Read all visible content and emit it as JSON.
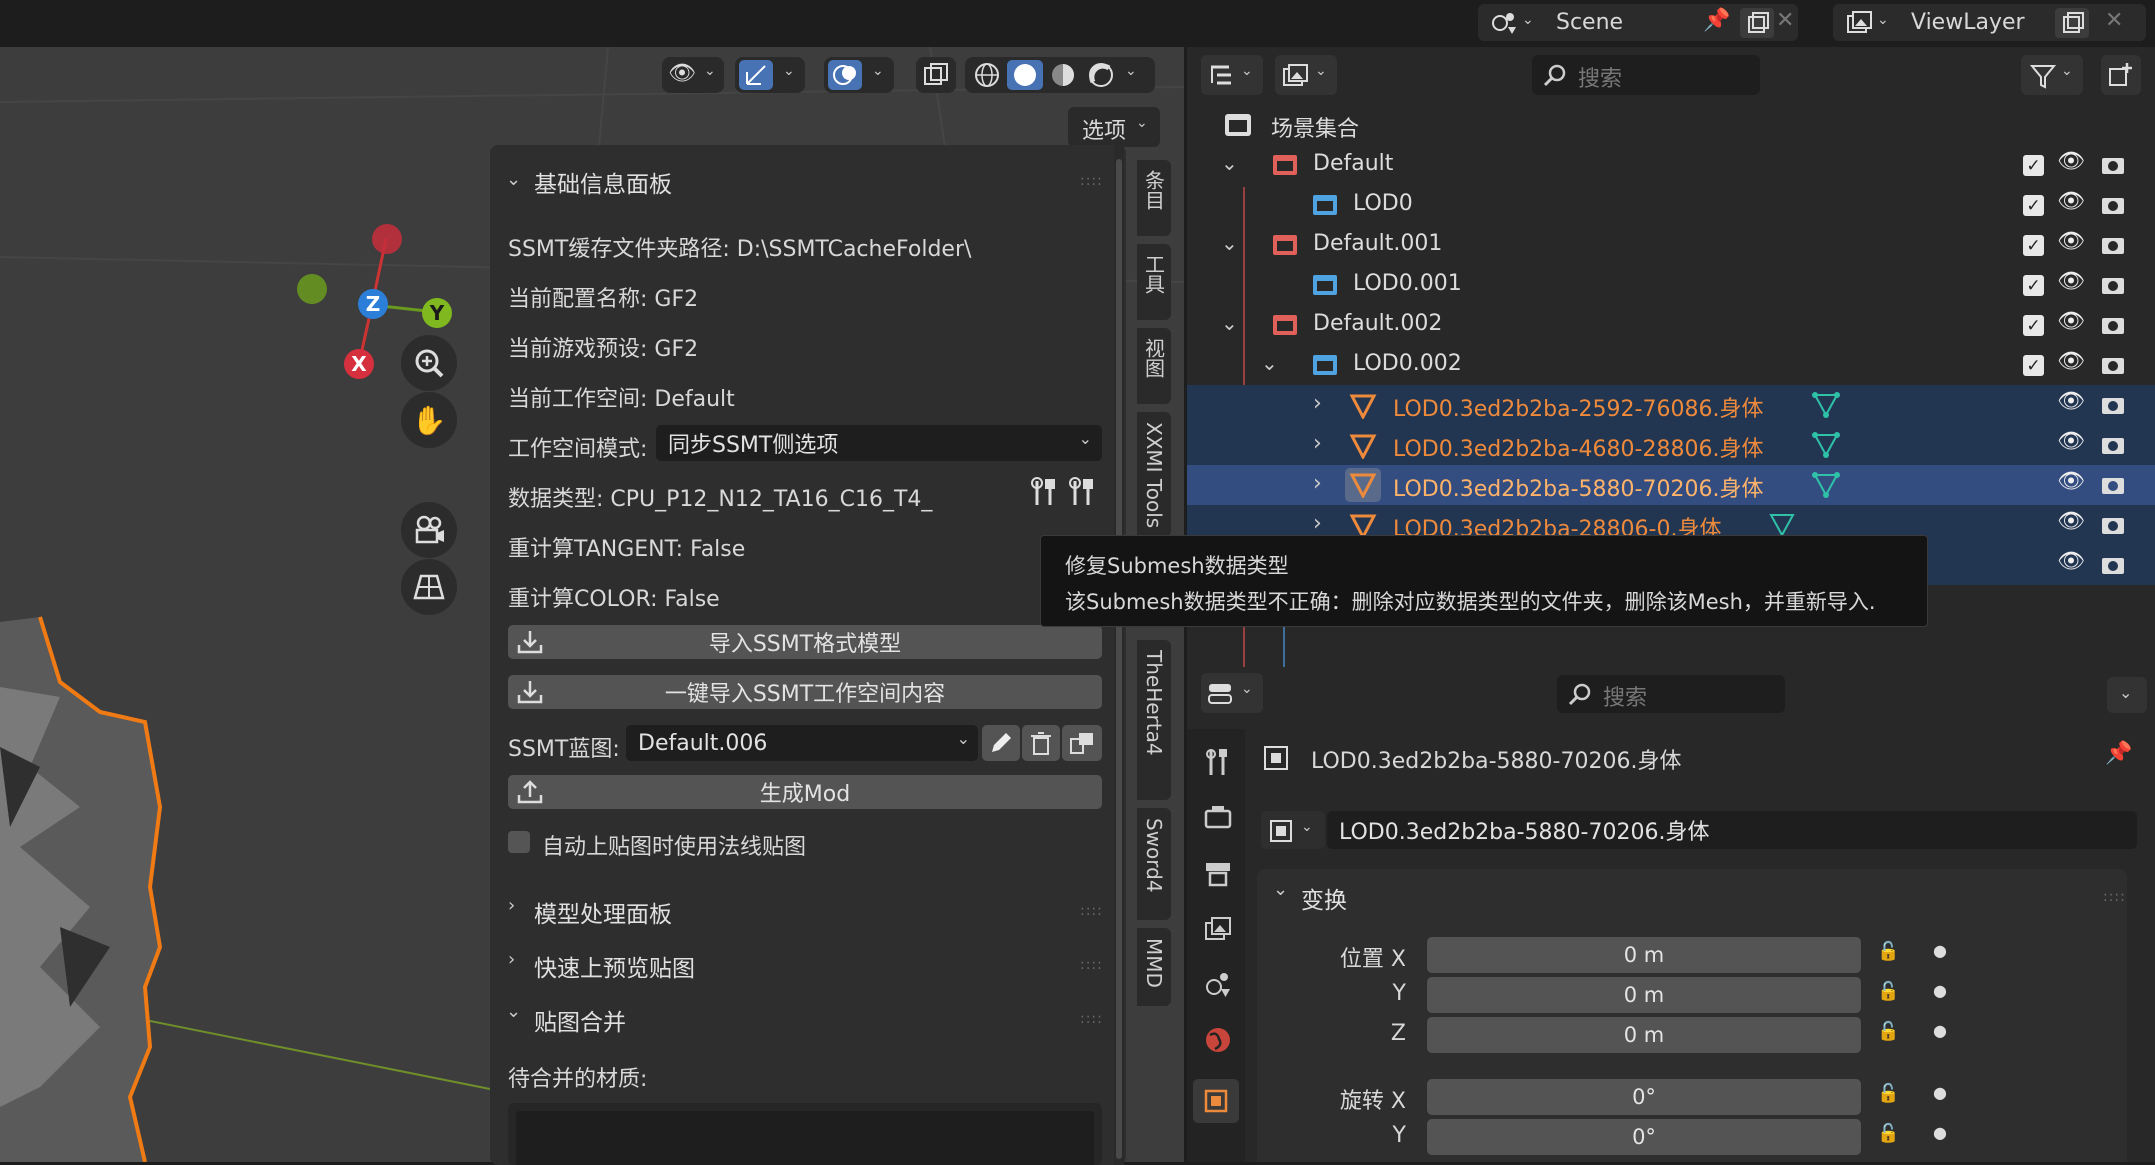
{
  "header": {
    "scene_label": "Scene",
    "viewlayer_label": "ViewLayer"
  },
  "viewport": {
    "options_label": "选项",
    "gizmo": {
      "x": "X",
      "y": "Y",
      "z": "Z"
    }
  },
  "npanel": {
    "basic_header": "基础信息面板",
    "cache_path": "SSMT缓存文件夹路径: D:\\SSMTCacheFolder\\",
    "config_name": "当前配置名称: GF2",
    "game_preset": "当前游戏预设: GF2",
    "workspace": "当前工作空间: Default",
    "workspace_mode_label": "工作空间模式:",
    "workspace_mode_value": "同步SSMT侧选项",
    "data_type": "数据类型: CPU_P12_N12_TA16_C16_T4_",
    "recalc_tangent": "重计算TANGENT: False",
    "recalc_color": "重计算COLOR: False",
    "import_model": "导入SSMT格式模型",
    "import_workspace": "一键导入SSMT工作空间内容",
    "blueprint_label": "SSMT蓝图:",
    "blueprint_value": "Default.006",
    "generate_mod": "生成Mod",
    "normal_map_checkbox": "自动上贴图时使用法线贴图",
    "model_panel": "模型处理面板",
    "quick_preview": "快速上预览贴图",
    "texture_merge": "贴图合并",
    "pending_materials": "待合并的材质:"
  },
  "side_tabs": [
    "条目",
    "工具",
    "视图",
    "XXMI Tools",
    "TheHerta4",
    "Sword4",
    "MMD"
  ],
  "outliner": {
    "search_placeholder": "搜索",
    "root": "场景集合",
    "rows": [
      {
        "label": "Default"
      },
      {
        "label": "LOD0"
      },
      {
        "label": "Default.001"
      },
      {
        "label": "LOD0.001"
      },
      {
        "label": "Default.002"
      },
      {
        "label": "LOD0.002"
      },
      {
        "label": "LOD0.3ed2b2ba-2592-76086.身体"
      },
      {
        "label": "LOD0.3ed2b2ba-4680-28806.身体"
      },
      {
        "label": "LOD0.3ed2b2ba-5880-70206.身体"
      },
      {
        "label": "LOD0.3ed2b2ba-28806-0.身体"
      }
    ]
  },
  "tooltip": {
    "title": "修复Submesh数据类型",
    "body": "该Submesh数据类型不正确：删除对应数据类型的文件夹，删除该Mesh，并重新导入."
  },
  "properties": {
    "search_placeholder": "搜索",
    "object_name": "LOD0.3ed2b2ba-5880-70206.身体",
    "object_field": "LOD0.3ed2b2ba-5880-70206.身体",
    "transform_header": "变换",
    "location_x_label": "位置 X",
    "y_label": "Y",
    "z_label": "Z",
    "location_x": "0 m",
    "location_y": "0 m",
    "location_z": "0 m",
    "rotation_x_label": "旋转 X",
    "rotation_y_label": "Y",
    "rotation_x": "0°",
    "rotation_y": "0°"
  },
  "colors": {
    "accent_blue": "#4772b3",
    "selection_orange": "#ee8a3c",
    "collection_red": "#e0605a",
    "collection_blue": "#4fa3e0",
    "mesh_teal": "#2fc2a8"
  }
}
